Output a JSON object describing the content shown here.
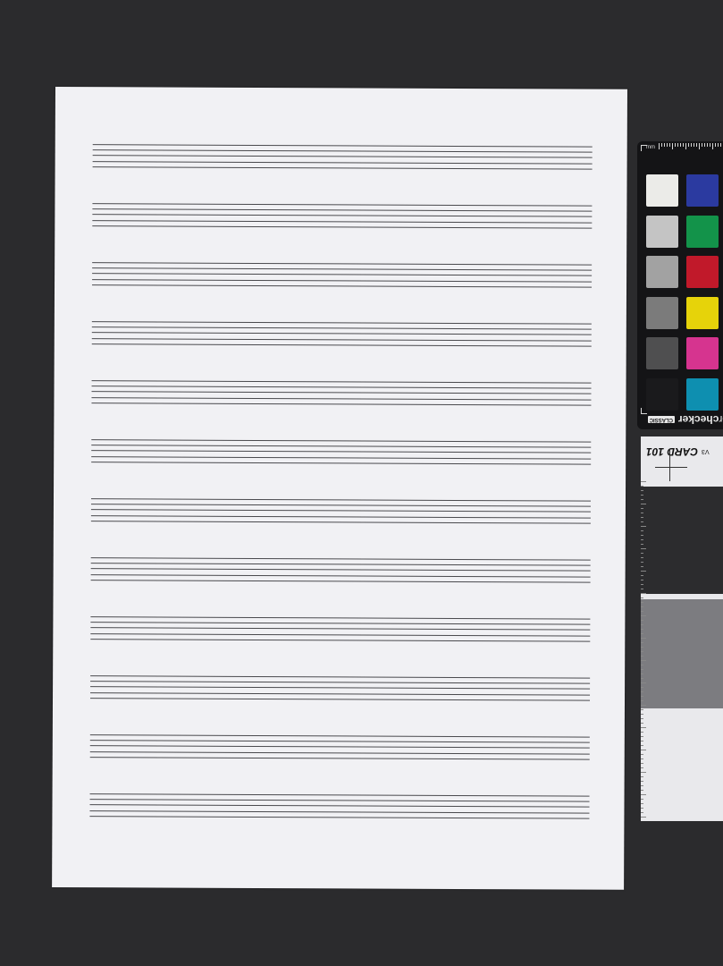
{
  "scene": {
    "description_kind": "photograph of blank music manuscript paper beside color calibration targets",
    "background_color": "#2b2b2d",
    "sheet_color": "#f1f1f4"
  },
  "sheet": {
    "staff_count": 12,
    "lines_per_staff": 5
  },
  "color_checker": {
    "brand_text": "checker",
    "brand_prefix": "or",
    "classic_badge": "CLASSIC",
    "ruler_unit": "mm",
    "patches": [
      [
        "#ebebe8",
        "#2b3aa0"
      ],
      [
        "#c4c4c4",
        "#13934a"
      ],
      [
        "#a2a2a2",
        "#c1192a"
      ],
      [
        "#7b7b7b",
        "#e6d30a"
      ],
      [
        "#4f4f50",
        "#d6348f"
      ],
      [
        "#1a1a1c",
        "#0e8fb0"
      ]
    ]
  },
  "grey_card": {
    "title": "CARD 101",
    "version": "V3",
    "bands": [
      "#e9e9ec",
      "#2c2c2e",
      "#7c7c80",
      "#e9e9ec"
    ]
  }
}
